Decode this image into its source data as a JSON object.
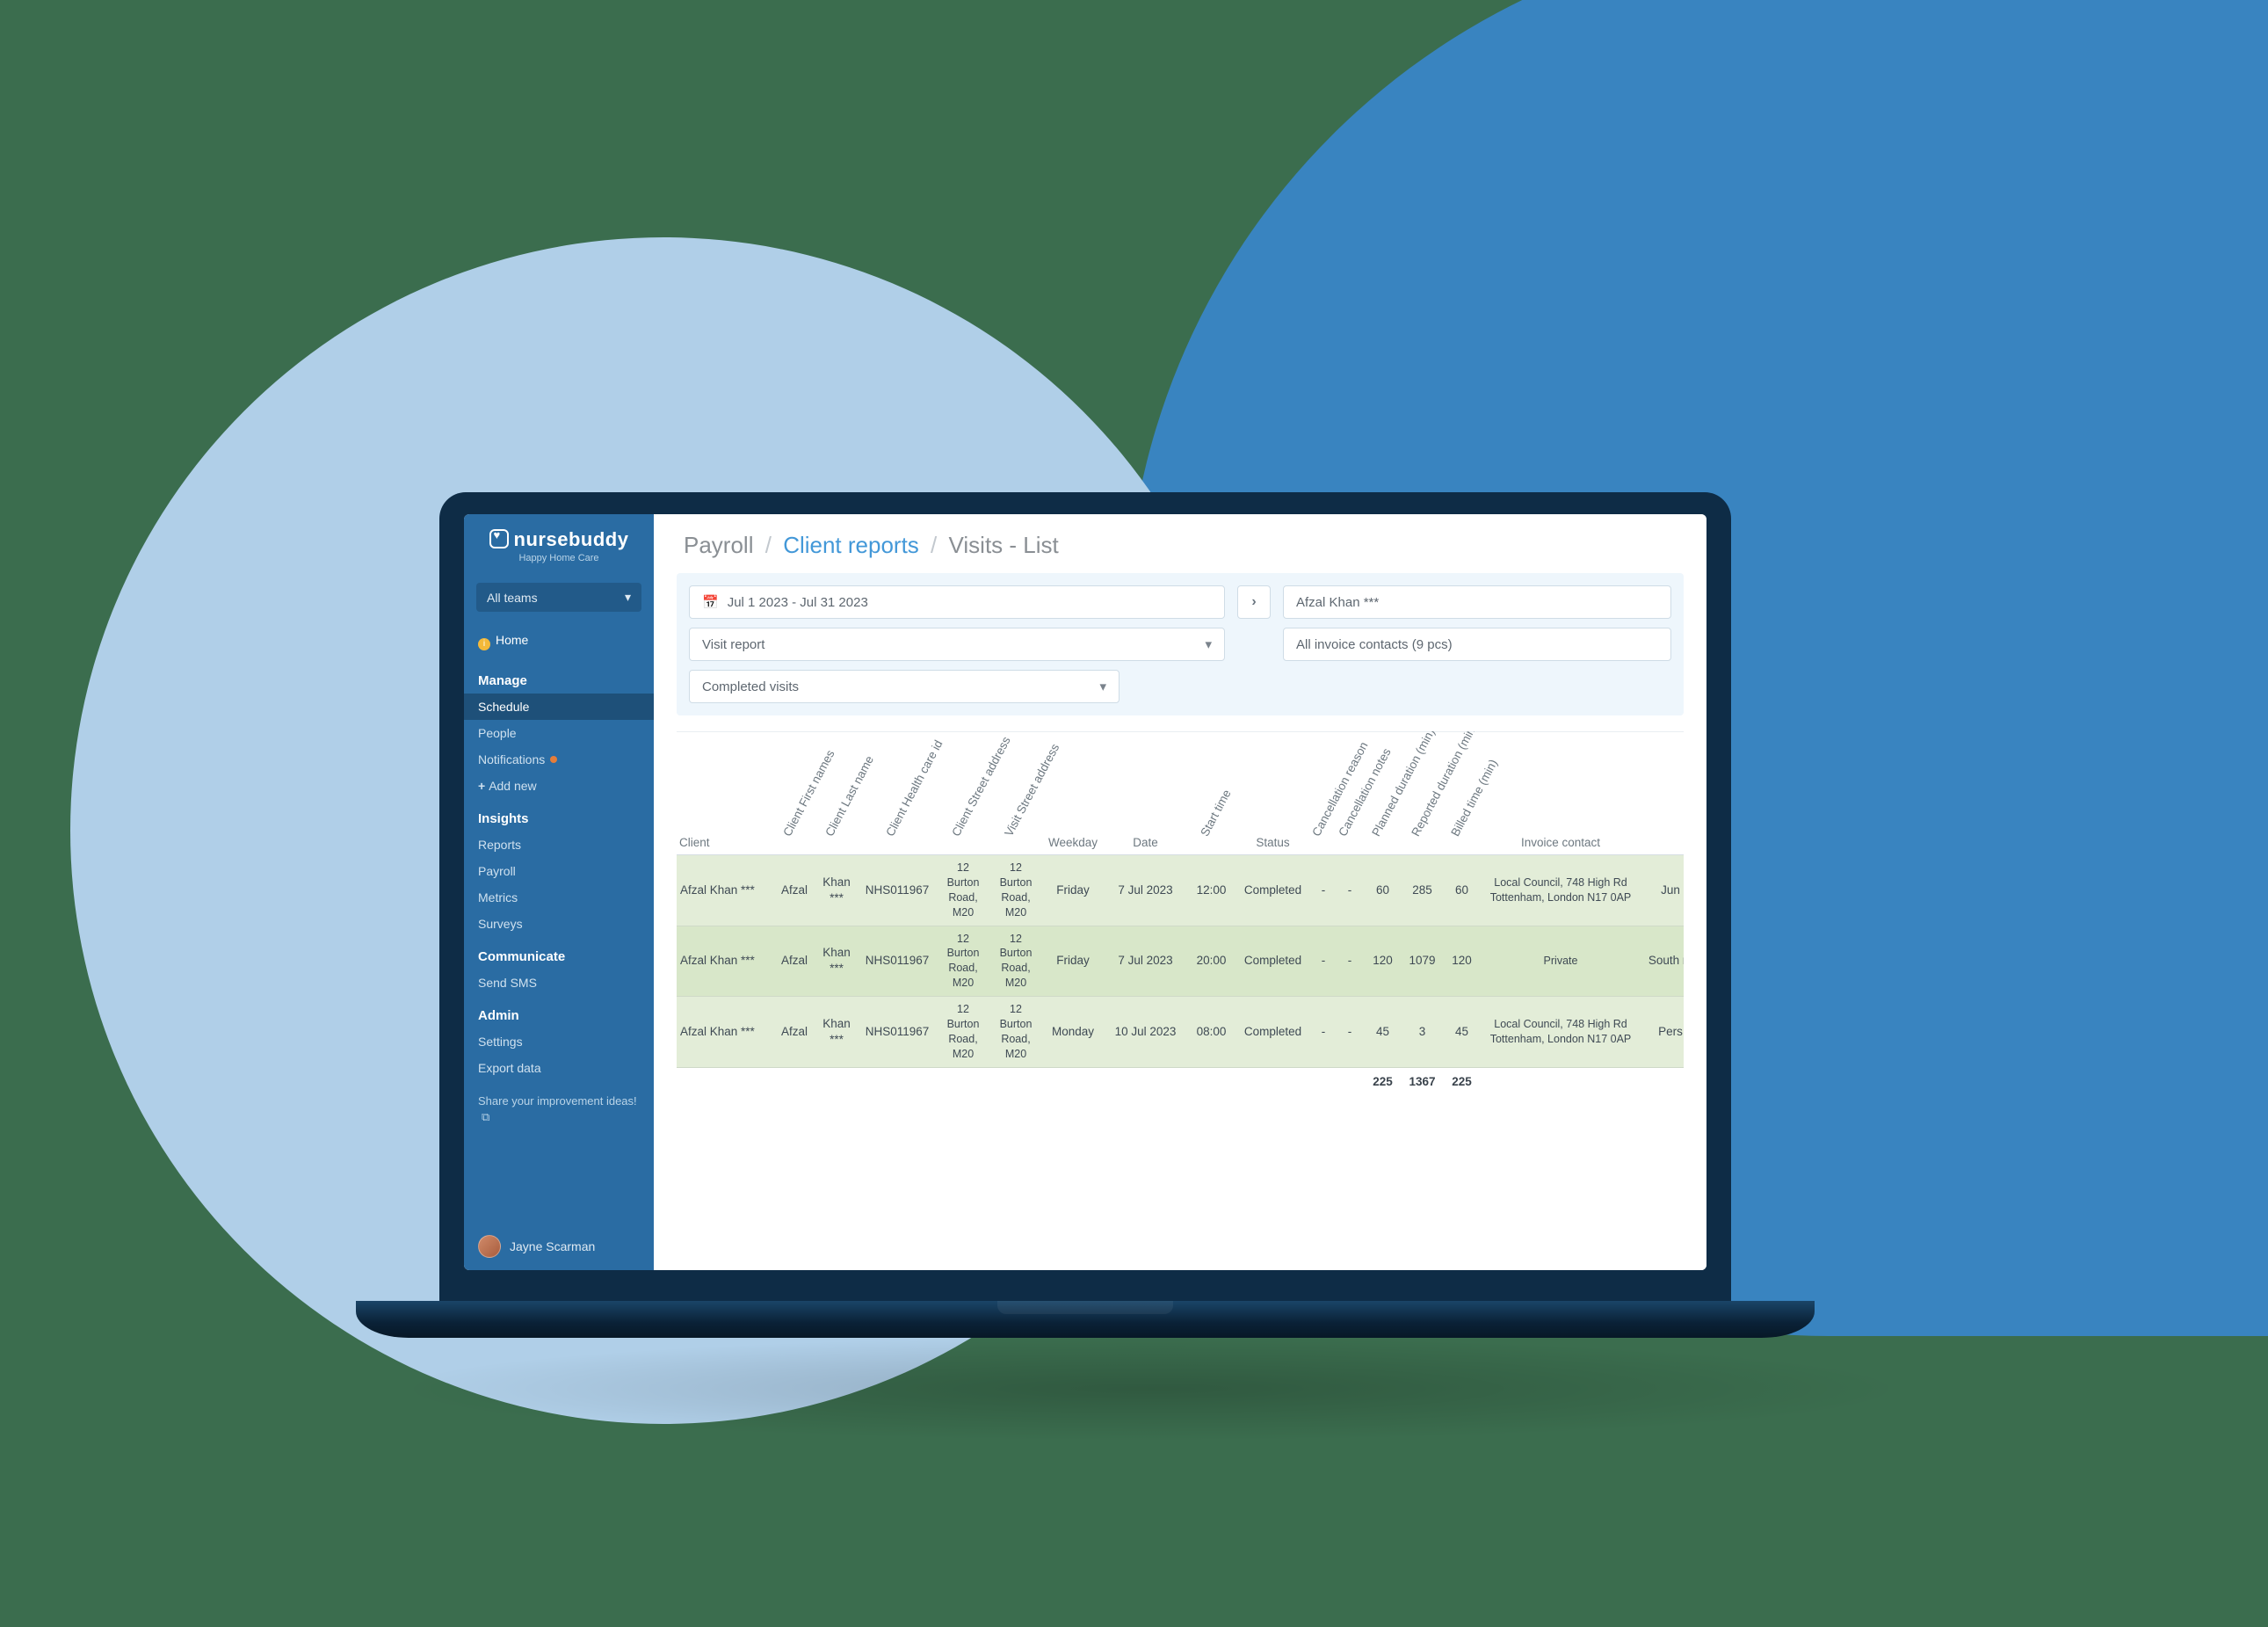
{
  "brand": {
    "name": "nursebuddy",
    "tagline": "Happy Home Care"
  },
  "team_selector": {
    "label": "All teams"
  },
  "home_link": "Home",
  "nav": {
    "manage": {
      "label": "Manage",
      "items": [
        {
          "label": "Schedule",
          "active": true
        },
        {
          "label": "People"
        },
        {
          "label": "Notifications",
          "badge": true
        },
        {
          "label": "Add new",
          "plus": true
        }
      ]
    },
    "insights": {
      "label": "Insights",
      "items": [
        {
          "label": "Reports"
        },
        {
          "label": "Payroll"
        },
        {
          "label": "Metrics"
        },
        {
          "label": "Surveys"
        }
      ]
    },
    "communicate": {
      "label": "Communicate",
      "items": [
        {
          "label": "Send SMS"
        }
      ]
    },
    "admin": {
      "label": "Admin",
      "items": [
        {
          "label": "Settings"
        },
        {
          "label": "Export data"
        }
      ]
    }
  },
  "feedback": "Share your improvement ideas!",
  "user": {
    "name": "Jayne Scarman"
  },
  "breadcrumb": {
    "a": "Payroll",
    "b": "Client reports",
    "c": "Visits - List"
  },
  "filters": {
    "date_range": "Jul 1 2023 - Jul 31 2023",
    "client": "Afzal Khan ***",
    "report_type": "Visit report",
    "invoice_contacts": "All invoice contacts (9 pcs)",
    "status": "Completed visits"
  },
  "columns": [
    "Client",
    "Client First names",
    "Client Last name",
    "Client Health care id",
    "Client Street address",
    "Visit Street address",
    "Weekday",
    "Date",
    "Start time",
    "Status",
    "Cancellation reason",
    "Cancellation notes",
    "Planned duration (min)",
    "Reported duration (min)",
    "Billed time (min)",
    "Invoice contact",
    ""
  ],
  "rows": [
    {
      "client": "Afzal Khan ***",
      "first": "Afzal",
      "last": "Khan ***",
      "hcid": "NHS011967",
      "c_addr": "12 Burton Road, M20",
      "v_addr": "12 Burton Road, M20",
      "weekday": "Friday",
      "date": "7 Jul 2023",
      "start": "12:00",
      "status": "Completed",
      "cr": "-",
      "cn": "-",
      "planned": "60",
      "reported": "285",
      "billed": "60",
      "contact": "Local Council, 748 High Rd Tottenham, London N17 0AP",
      "over": "Jun"
    },
    {
      "client": "Afzal Khan ***",
      "first": "Afzal",
      "last": "Khan ***",
      "hcid": "NHS011967",
      "c_addr": "12 Burton Road, M20",
      "v_addr": "12 Burton Road, M20",
      "weekday": "Friday",
      "date": "7 Jul 2023",
      "start": "20:00",
      "status": "Completed",
      "cr": "-",
      "cn": "-",
      "planned": "120",
      "reported": "1079",
      "billed": "120",
      "contact": "Private",
      "over": "South m"
    },
    {
      "client": "Afzal Khan ***",
      "first": "Afzal",
      "last": "Khan ***",
      "hcid": "NHS011967",
      "c_addr": "12 Burton Road, M20",
      "v_addr": "12 Burton Road, M20",
      "weekday": "Monday",
      "date": "10 Jul 2023",
      "start": "08:00",
      "status": "Completed",
      "cr": "-",
      "cn": "-",
      "planned": "45",
      "reported": "3",
      "billed": "45",
      "contact": "Local Council, 748 High Rd Tottenham, London N17 0AP",
      "over": "Pers"
    }
  ],
  "totals": {
    "planned": "225",
    "reported": "1367",
    "billed": "225"
  }
}
